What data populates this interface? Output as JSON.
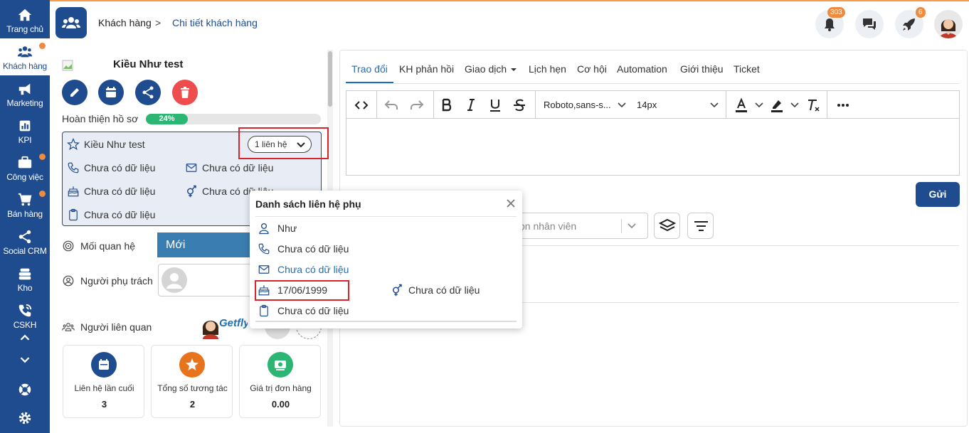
{
  "nav": {
    "items": [
      {
        "label": "Trang chủ",
        "icon": "home-icon"
      },
      {
        "label": "Khách hàng",
        "icon": "customers-icon"
      },
      {
        "label": "Marketing",
        "icon": "megaphone-icon"
      },
      {
        "label": "KPI",
        "icon": "chart-icon"
      },
      {
        "label": "Công việc",
        "icon": "briefcase-icon"
      },
      {
        "label": "Bán hàng",
        "icon": "cart-icon"
      },
      {
        "label": "Social CRM",
        "icon": "share-icon"
      },
      {
        "label": "Kho",
        "icon": "warehouse-icon"
      },
      {
        "label": "CSKH",
        "icon": "phone-call-icon"
      }
    ]
  },
  "header": {
    "breadcrumb_1": "Khách hàng",
    "breadcrumb_sep": ">",
    "breadcrumb_2": "Chi tiết khách hàng",
    "notif_count": "303",
    "rocket_count": "6"
  },
  "customer": {
    "name": "Kiều Như test",
    "profile_label": "Hoàn thiện hồ sơ",
    "profile_percent": "24%",
    "profile_fraction": 0.24,
    "card_name": "Kiều Như test",
    "contact_select": "1 liên hệ",
    "phone": "Chưa có dữ liệu",
    "email": "Chưa có dữ liệu",
    "birthday": "Chưa có dữ liệu",
    "gender": "Chưa có dữ liệu",
    "note": "Chưa có dữ liệu",
    "relation_label": "Mối quan hệ",
    "relation_value": "Mới",
    "owner_label": "Người phụ trách",
    "related_label": "Người liên quan",
    "related_logo_text": "Getfly"
  },
  "stats": [
    {
      "label": "Liên hệ lần cuối",
      "value": "3",
      "color": "#1f4c8f"
    },
    {
      "label": "Tổng số tương tác",
      "value": "2",
      "color": "#e8731d"
    },
    {
      "label": "Giá trị đơn hàng",
      "value": "0.00",
      "color": "#2bb673"
    }
  ],
  "tabs": [
    {
      "label": "Trao đổi"
    },
    {
      "label": "KH phản hồi"
    },
    {
      "label": "Giao dịch"
    },
    {
      "label": "Lịch hẹn"
    },
    {
      "label": "Cơ hội"
    },
    {
      "label": "Automation"
    },
    {
      "label": "Giới thiệu"
    },
    {
      "label": "Ticket"
    }
  ],
  "editor": {
    "font_family": "Roboto,sans-s...",
    "font_size": "14px",
    "send_label": "Gửi",
    "staff_placeholder": "ọn nhân viên"
  },
  "popup": {
    "title": "Danh sách liên hệ phụ",
    "name": "Như",
    "phone": "Chưa có dữ liệu",
    "email": "Chưa có dữ liệu",
    "birthday": "17/06/1999",
    "gender": "Chưa có dữ liệu",
    "note": "Chưa có dữ liệu"
  },
  "colors": {
    "brand": "#1f4c8f",
    "accent_orange": "#f08a3c",
    "highlight_red": "#d9232d",
    "progress_green": "#2bb673",
    "link_blue": "#1f6fb5"
  }
}
